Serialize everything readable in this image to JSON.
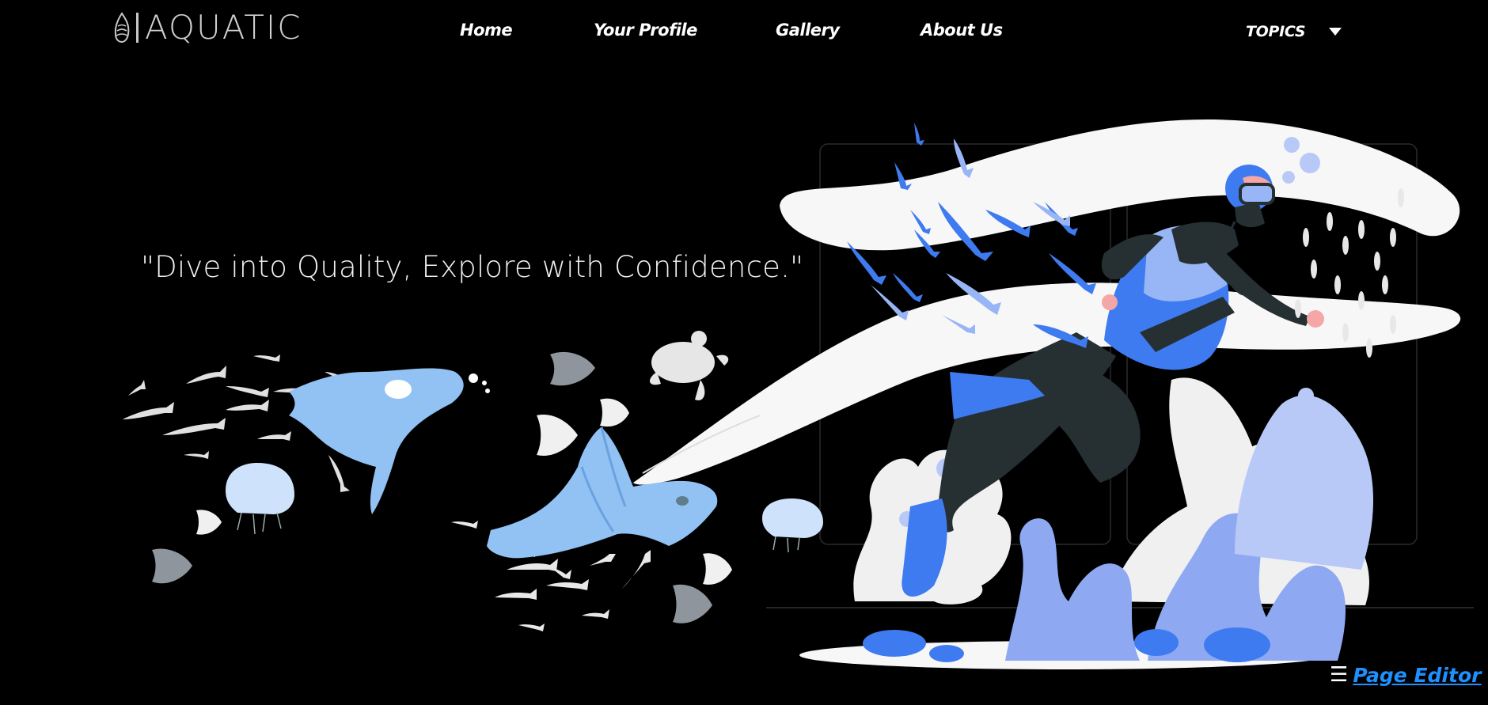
{
  "brand": {
    "name": "AQUATIC"
  },
  "nav": {
    "links": [
      {
        "label": "Home"
      },
      {
        "label": "Your Profile"
      },
      {
        "label": "Gallery"
      },
      {
        "label": "About Us"
      }
    ],
    "topics_label": "TOPICS"
  },
  "hero": {
    "tagline": "\"Dive into Quality, Explore with Confidence.\""
  },
  "footer": {
    "editor_icon": "☰",
    "editor_label": "Page Editor"
  },
  "colors": {
    "background": "#000000",
    "accent_blue": "#3f7bf0",
    "light_blue": "#92c2f4",
    "pale_blue": "#b9c9f7",
    "link_blue": "#1e90ff",
    "wave_white": "#f7f7f7"
  }
}
